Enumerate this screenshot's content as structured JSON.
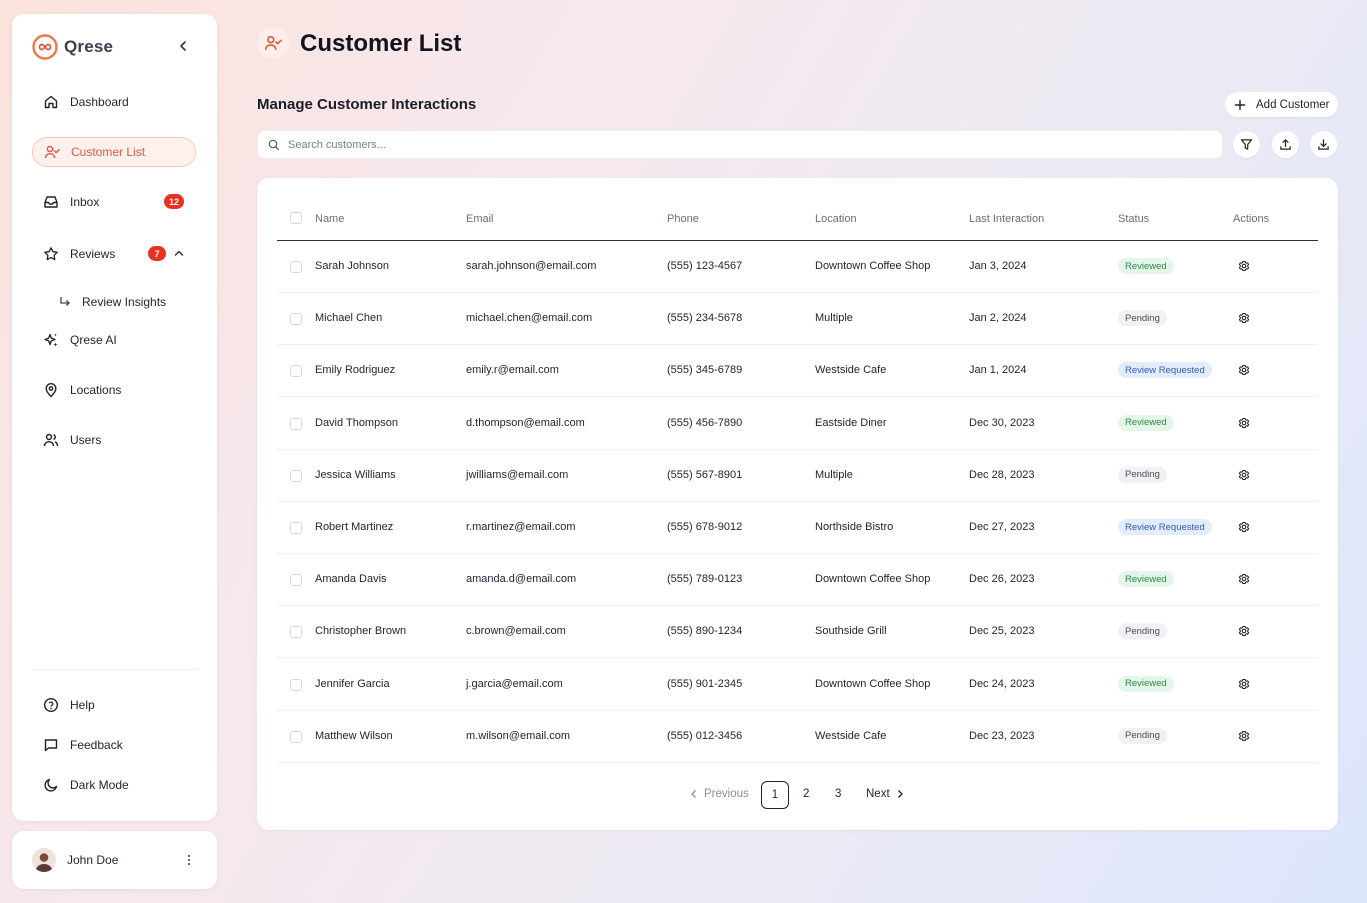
{
  "brand": {
    "name": "Qrese",
    "accent": "#e2563c"
  },
  "sidebar": {
    "items": [
      {
        "label": "Dashboard",
        "icon": "home-icon"
      },
      {
        "label": "Customer List",
        "icon": "user-check-icon",
        "active": true
      },
      {
        "label": "Inbox",
        "icon": "inbox-icon",
        "badge": "12"
      },
      {
        "label": "Reviews",
        "icon": "star-icon",
        "badge": "7",
        "expanded": true
      },
      {
        "label": "Qrese AI",
        "icon": "sparkles-icon"
      },
      {
        "label": "Locations",
        "icon": "map-pin-icon"
      },
      {
        "label": "Users",
        "icon": "users-icon"
      }
    ],
    "sub_item": {
      "label": "Review Insights",
      "icon": "corner-down-right-icon"
    },
    "bottom": [
      {
        "label": "Help",
        "icon": "help-circle-icon"
      },
      {
        "label": "Feedback",
        "icon": "message-square-icon"
      },
      {
        "label": "Dark Mode",
        "icon": "moon-icon"
      }
    ]
  },
  "user": {
    "name": "John Doe"
  },
  "header": {
    "title": "Customer List",
    "subtitle": "Manage Customer Interactions",
    "add_label": "Add Customer"
  },
  "search": {
    "placeholder": "Search customers..."
  },
  "table": {
    "columns": [
      "Name",
      "Email",
      "Phone",
      "Location",
      "Last Interaction",
      "Status",
      "Actions"
    ],
    "rows": [
      {
        "name": "Sarah Johnson",
        "email": "sarah.johnson@email.com",
        "phone": "(555) 123-4567",
        "location": "Downtown Coffee Shop",
        "last": "Jan 3, 2024",
        "status": "Reviewed"
      },
      {
        "name": "Michael Chen",
        "email": "michael.chen@email.com",
        "phone": "(555) 234-5678",
        "location": "Multiple",
        "last": "Jan 2, 2024",
        "status": "Pending"
      },
      {
        "name": "Emily Rodriguez",
        "email": "emily.r@email.com",
        "phone": "(555) 345-6789",
        "location": "Westside Cafe",
        "last": "Jan 1, 2024",
        "status": "Review Requested"
      },
      {
        "name": "David Thompson",
        "email": "d.thompson@email.com",
        "phone": "(555) 456-7890",
        "location": "Eastside Diner",
        "last": "Dec 30, 2023",
        "status": "Reviewed"
      },
      {
        "name": "Jessica Williams",
        "email": "jwilliams@email.com",
        "phone": "(555) 567-8901",
        "location": "Multiple",
        "last": "Dec 28, 2023",
        "status": "Pending"
      },
      {
        "name": "Robert Martinez",
        "email": "r.martinez@email.com",
        "phone": "(555) 678-9012",
        "location": "Northside Bistro",
        "last": "Dec 27, 2023",
        "status": "Review Requested"
      },
      {
        "name": "Amanda Davis",
        "email": "amanda.d@email.com",
        "phone": "(555) 789-0123",
        "location": "Downtown Coffee Shop",
        "last": "Dec 26, 2023",
        "status": "Reviewed"
      },
      {
        "name": "Christopher Brown",
        "email": "c.brown@email.com",
        "phone": "(555) 890-1234",
        "location": "Southside Grill",
        "last": "Dec 25, 2023",
        "status": "Pending"
      },
      {
        "name": "Jennifer Garcia",
        "email": "j.garcia@email.com",
        "phone": "(555) 901-2345",
        "location": "Downtown Coffee Shop",
        "last": "Dec 24, 2023",
        "status": "Reviewed"
      },
      {
        "name": "Matthew Wilson",
        "email": "m.wilson@email.com",
        "phone": "(555) 012-3456",
        "location": "Westside Cafe",
        "last": "Dec 23, 2023",
        "status": "Pending"
      }
    ]
  },
  "status_styles": {
    "Reviewed": {
      "bg": "#e3f6e9",
      "fg": "#2e8a4c"
    },
    "Pending": {
      "bg": "#f1f1f4",
      "fg": "#4a4d5a"
    },
    "Review Requested": {
      "bg": "#e2ecfb",
      "fg": "#3560b5"
    }
  },
  "pagination": {
    "previous": "Previous",
    "pages": [
      "1",
      "2",
      "3"
    ],
    "current": "1",
    "next": "Next"
  }
}
